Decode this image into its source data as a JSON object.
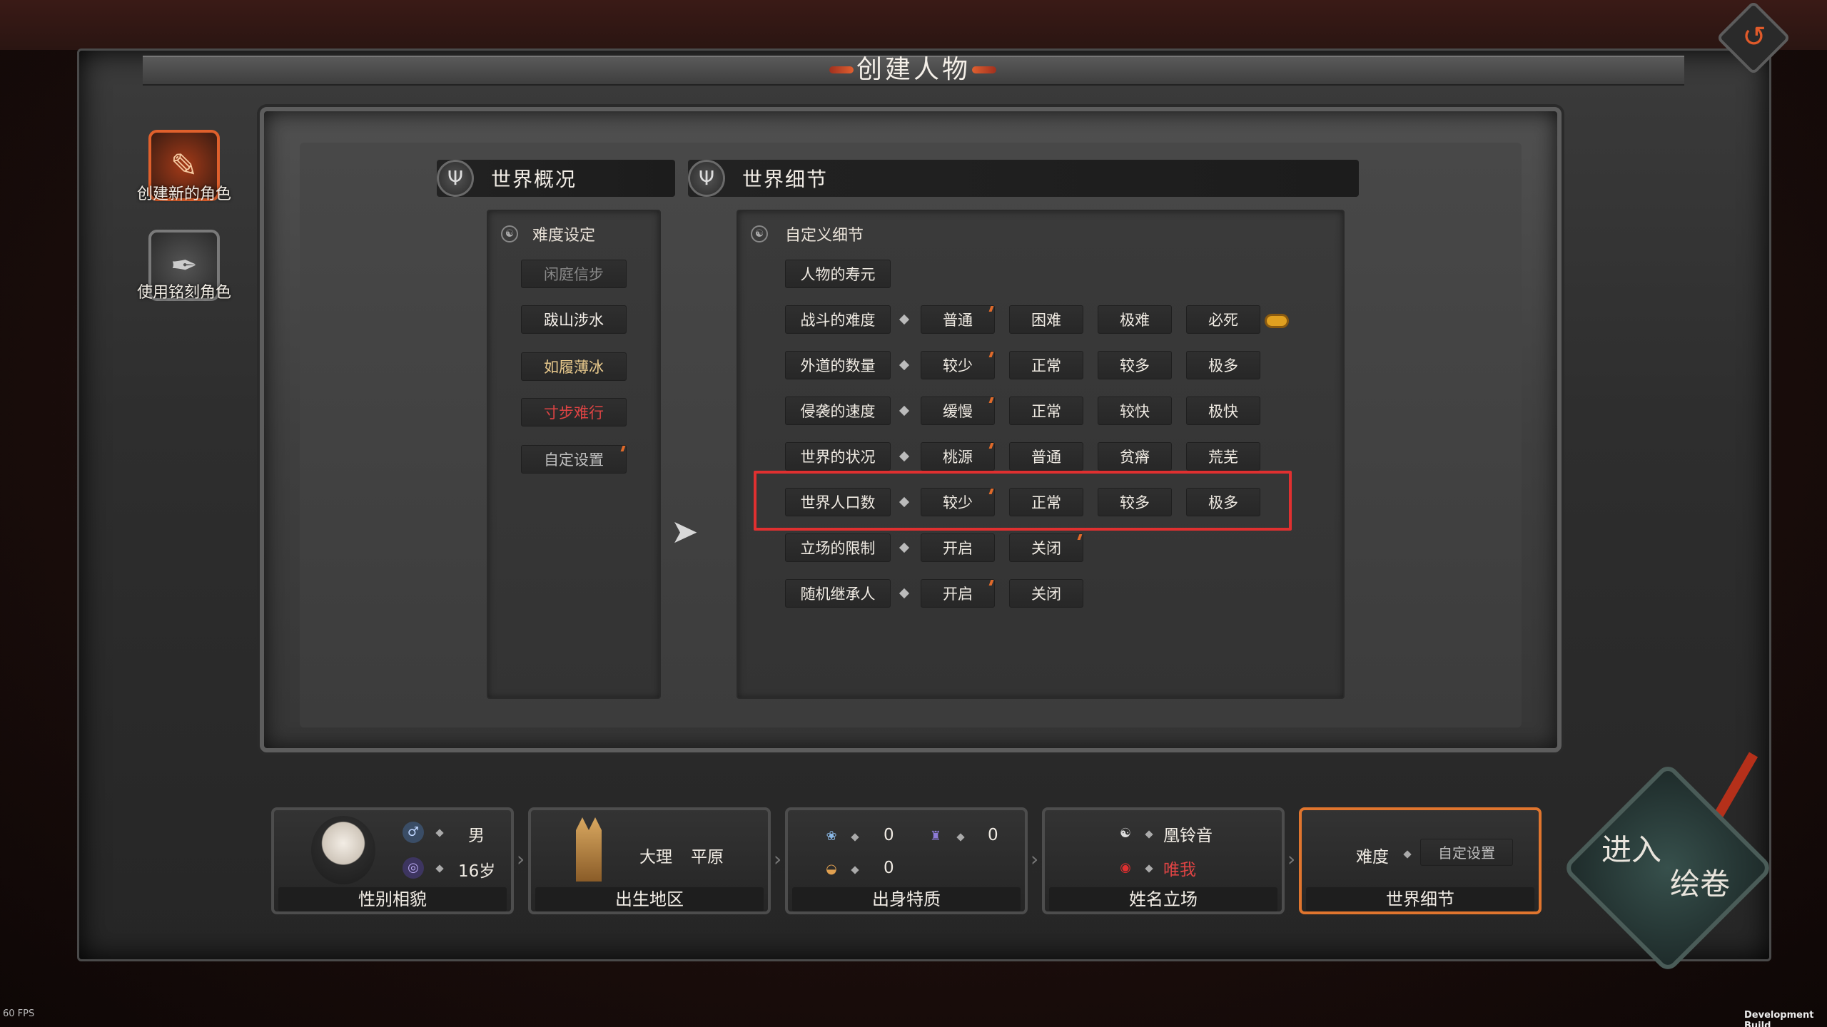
{
  "title": "创建人物",
  "fps": "60 FPS",
  "build_label": "Development Build",
  "side_menu": [
    {
      "label": "创建新的角色",
      "icon": "create-character-icon"
    },
    {
      "label": "使用铭刻角色",
      "icon": "engraved-character-icon"
    }
  ],
  "overview": {
    "header": "世界概况",
    "difficulty_title": "难度设定",
    "difficulty_options": [
      "闲庭信步",
      "跋山涉水",
      "如履薄冰",
      "寸步难行",
      "自定设置"
    ]
  },
  "detail": {
    "header": "世界细节",
    "custom_title": "自定义细节",
    "rows": [
      {
        "label": "人物的寿元",
        "options": []
      },
      {
        "label": "战斗的难度",
        "options": [
          "普通",
          "困难",
          "极难",
          "必死"
        ]
      },
      {
        "label": "外道的数量",
        "options": [
          "较少",
          "正常",
          "较多",
          "极多"
        ]
      },
      {
        "label": "侵袭的速度",
        "options": [
          "缓慢",
          "正常",
          "较快",
          "极快"
        ]
      },
      {
        "label": "世界的状况",
        "options": [
          "桃源",
          "普通",
          "贫瘠",
          "荒芜"
        ]
      },
      {
        "label": "世界人口数",
        "options": [
          "较少",
          "正常",
          "较多",
          "极多"
        ]
      },
      {
        "label": "立场的限制",
        "options": [
          "开启",
          "关闭"
        ]
      },
      {
        "label": "随机继承人",
        "options": [
          "开启",
          "关闭"
        ]
      }
    ]
  },
  "cards": {
    "appearance": {
      "title": "性别相貌",
      "gender": "男",
      "age": "16岁"
    },
    "birthplace": {
      "title": "出生地区",
      "city": "大理",
      "terrain": "平原"
    },
    "traits": {
      "title": "出身特质",
      "v1": "0",
      "v2": "0",
      "v3": "0"
    },
    "name": {
      "title": "姓名立场",
      "name": "凰铃音",
      "stance": "唯我"
    },
    "world": {
      "title": "世界细节",
      "label": "难度",
      "value": "自定设置"
    }
  },
  "enter_button": {
    "line1": "进入",
    "line2": "绘卷"
  },
  "colors": {
    "accent_orange": "#e0752e",
    "highlight_red": "#e03030",
    "danger_red": "#e04444",
    "gold": "#e0a020"
  }
}
